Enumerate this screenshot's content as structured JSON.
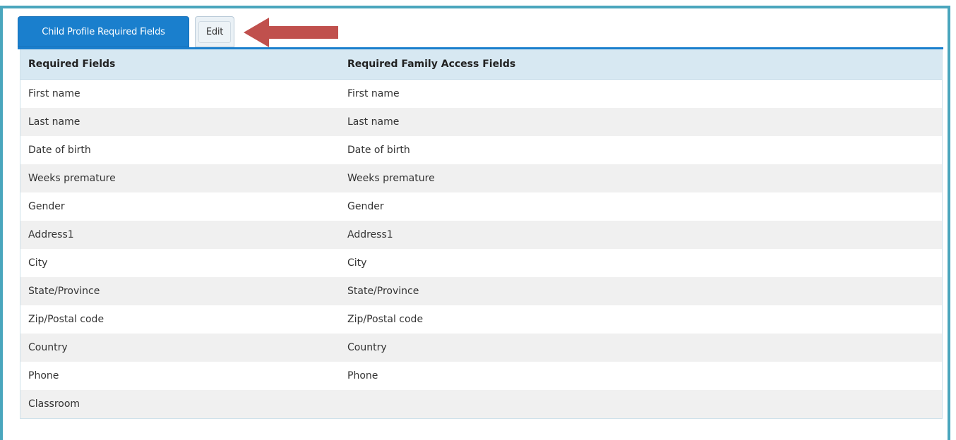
{
  "tabs": {
    "active_label": "Child Profile Required Fields",
    "edit_label": "Edit"
  },
  "colors": {
    "frame": "#4aa6bd",
    "active_tab": "#1a7fcd",
    "header_bg": "#d7e8f2",
    "arrow": "#c0504d"
  },
  "table": {
    "headers": [
      "Required Fields",
      "Required Family Access Fields"
    ],
    "rows": [
      [
        "First name",
        "First name"
      ],
      [
        "Last name",
        "Last name"
      ],
      [
        "Date of birth",
        "Date of birth"
      ],
      [
        "Weeks premature",
        "Weeks premature"
      ],
      [
        "Gender",
        "Gender"
      ],
      [
        "Address1",
        "Address1"
      ],
      [
        "City",
        "City"
      ],
      [
        "State/Province",
        "State/Province"
      ],
      [
        "Zip/Postal code",
        "Zip/Postal code"
      ],
      [
        "Country",
        "Country"
      ],
      [
        "Phone",
        "Phone"
      ],
      [
        "Classroom",
        ""
      ]
    ]
  }
}
